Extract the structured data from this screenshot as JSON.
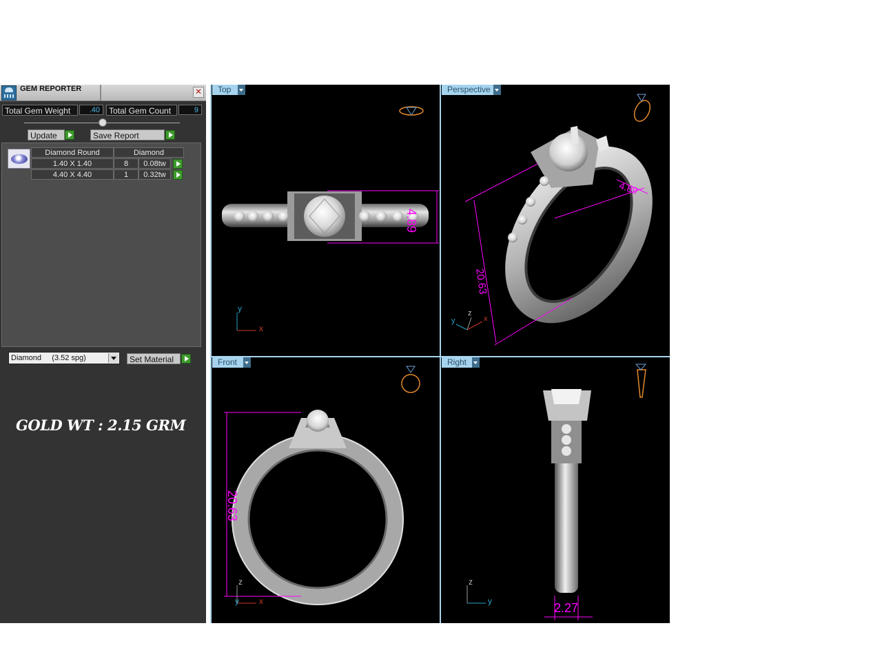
{
  "panel": {
    "title": "GEM REPORTER",
    "total_gem_weight_label": "Total Gem Weight",
    "total_gem_weight_value": ".40",
    "total_gem_count_label": "Total Gem Count",
    "total_gem_count_value": "9",
    "update_label": "Update",
    "save_report_label": "Save Report",
    "table": {
      "headers": [
        "Diamond Round",
        "Diamond"
      ],
      "rows": [
        {
          "size": "1.40 X 1.40",
          "count": "8",
          "weight": "0.08tw"
        },
        {
          "size": "4.40 X 4.40",
          "count": "1",
          "weight": "0.32tw"
        }
      ]
    },
    "material_select_value": "Diamond     (3.52 spg)",
    "set_material_label": "Set Material",
    "gold_weight": "GOLD WT : 2.15 GRM"
  },
  "viewports": {
    "top": {
      "label": "Top",
      "dimension": "4.89",
      "axis_x": "x",
      "axis_y": "y"
    },
    "perspective": {
      "label": "Perspective",
      "dimension_a": "20.63",
      "dimension_b": "4.89",
      "axis_x": "x",
      "axis_y": "y",
      "axis_z": "z"
    },
    "front": {
      "label": "Front",
      "dimension": "20.63",
      "axis_x": "x",
      "axis_y": "y",
      "axis_z": "z"
    },
    "right": {
      "label": "Right",
      "dimension": "2.27",
      "axis_y": "y",
      "axis_z": "z"
    }
  },
  "colors": {
    "dimension": "#ff00ff",
    "metal": "#c8c8c8",
    "viewport_tab": "#a6d4ee",
    "panel_bg": "#333333",
    "value_text": "#4fb7e6"
  }
}
